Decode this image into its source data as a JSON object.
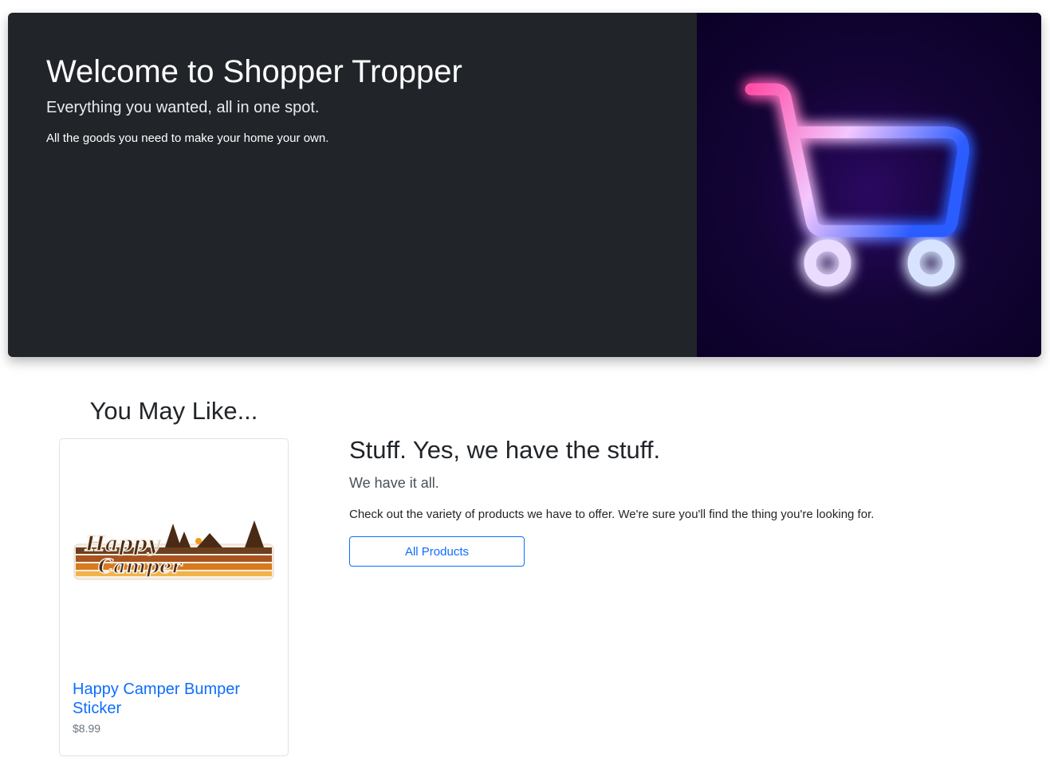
{
  "hero": {
    "title": "Welcome to Shopper Tropper",
    "lead": "Everything you wanted, all in one spot.",
    "description": "All the goods you need to make your home your own.",
    "image_icon": "neon-shopping-cart-icon"
  },
  "sidebar": {
    "title": "You May Like...",
    "card": {
      "image_icon": "happy-camper-sticker-image",
      "image_text_line1": "Happy",
      "image_text_line2": "Camper",
      "title": "Happy Camper Bumper Sticker",
      "price": "$8.99"
    }
  },
  "main": {
    "title": "Stuff. Yes, we have the stuff.",
    "lead": "We have it all.",
    "description": "Check out the variety of products we have to offer. We're sure you'll find the thing you're looking for.",
    "button_label": "All Products"
  },
  "colors": {
    "hero_bg": "#212529",
    "link": "#0d6efd",
    "muted": "#6c757d",
    "neon_pink": "#ff4fa8",
    "neon_blue": "#2a5bff"
  }
}
